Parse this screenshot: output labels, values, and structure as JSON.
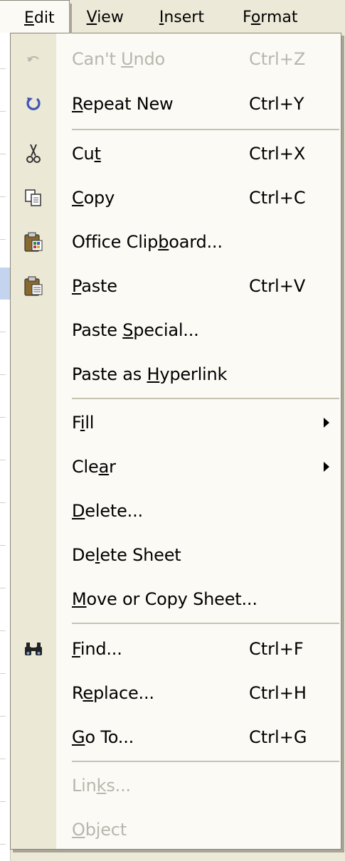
{
  "menubar": {
    "items": [
      {
        "pre": "",
        "key": "E",
        "post": "dit"
      },
      {
        "pre": "",
        "key": "V",
        "post": "iew"
      },
      {
        "pre": "",
        "key": "I",
        "post": "nsert"
      },
      {
        "pre": "F",
        "key": "o",
        "post": "rmat"
      }
    ]
  },
  "menu": {
    "items": [
      {
        "pre": "Can't ",
        "key": "U",
        "post": "ndo",
        "shortcut": "Ctrl+Z",
        "icon": "undo-icon",
        "enabled": false
      },
      {
        "pre": "",
        "key": "R",
        "post": "epeat New",
        "shortcut": "Ctrl+Y",
        "icon": "redo-icon",
        "enabled": true
      },
      {
        "pre": "Cu",
        "key": "t",
        "post": "",
        "shortcut": "Ctrl+X",
        "icon": "scissors-icon",
        "enabled": true
      },
      {
        "pre": "",
        "key": "C",
        "post": "opy",
        "shortcut": "Ctrl+C",
        "icon": "copy-icon",
        "enabled": true
      },
      {
        "pre": "Office Clip",
        "key": "b",
        "post": "oard...",
        "shortcut": "",
        "icon": "clipboard-icon",
        "enabled": true
      },
      {
        "pre": "",
        "key": "P",
        "post": "aste",
        "shortcut": "Ctrl+V",
        "icon": "paste-icon",
        "enabled": true
      },
      {
        "pre": "Paste ",
        "key": "S",
        "post": "pecial...",
        "shortcut": "",
        "icon": "",
        "enabled": true
      },
      {
        "pre": "Paste as ",
        "key": "H",
        "post": "yperlink",
        "shortcut": "",
        "icon": "",
        "enabled": true
      },
      {
        "pre": "F",
        "key": "i",
        "post": "ll",
        "shortcut": "",
        "icon": "",
        "enabled": true,
        "submenu": true
      },
      {
        "pre": "Cle",
        "key": "a",
        "post": "r",
        "shortcut": "",
        "icon": "",
        "enabled": true,
        "submenu": true
      },
      {
        "pre": "",
        "key": "D",
        "post": "elete...",
        "shortcut": "",
        "icon": "",
        "enabled": true
      },
      {
        "pre": "De",
        "key": "l",
        "post": "ete Sheet",
        "shortcut": "",
        "icon": "",
        "enabled": true
      },
      {
        "pre": "",
        "key": "M",
        "post": "ove or Copy Sheet...",
        "shortcut": "",
        "icon": "",
        "enabled": true
      },
      {
        "pre": "",
        "key": "F",
        "post": "ind...",
        "shortcut": "Ctrl+F",
        "icon": "binoculars-icon",
        "enabled": true
      },
      {
        "pre": "R",
        "key": "e",
        "post": "place...",
        "shortcut": "Ctrl+H",
        "icon": "",
        "enabled": true
      },
      {
        "pre": "",
        "key": "G",
        "post": "o To...",
        "shortcut": "Ctrl+G",
        "icon": "",
        "enabled": true
      },
      {
        "pre": "Lin",
        "key": "k",
        "post": "s...",
        "shortcut": "",
        "icon": "",
        "enabled": false
      },
      {
        "pre": "",
        "key": "O",
        "post": "bject",
        "shortcut": "",
        "icon": "",
        "enabled": false
      }
    ]
  }
}
